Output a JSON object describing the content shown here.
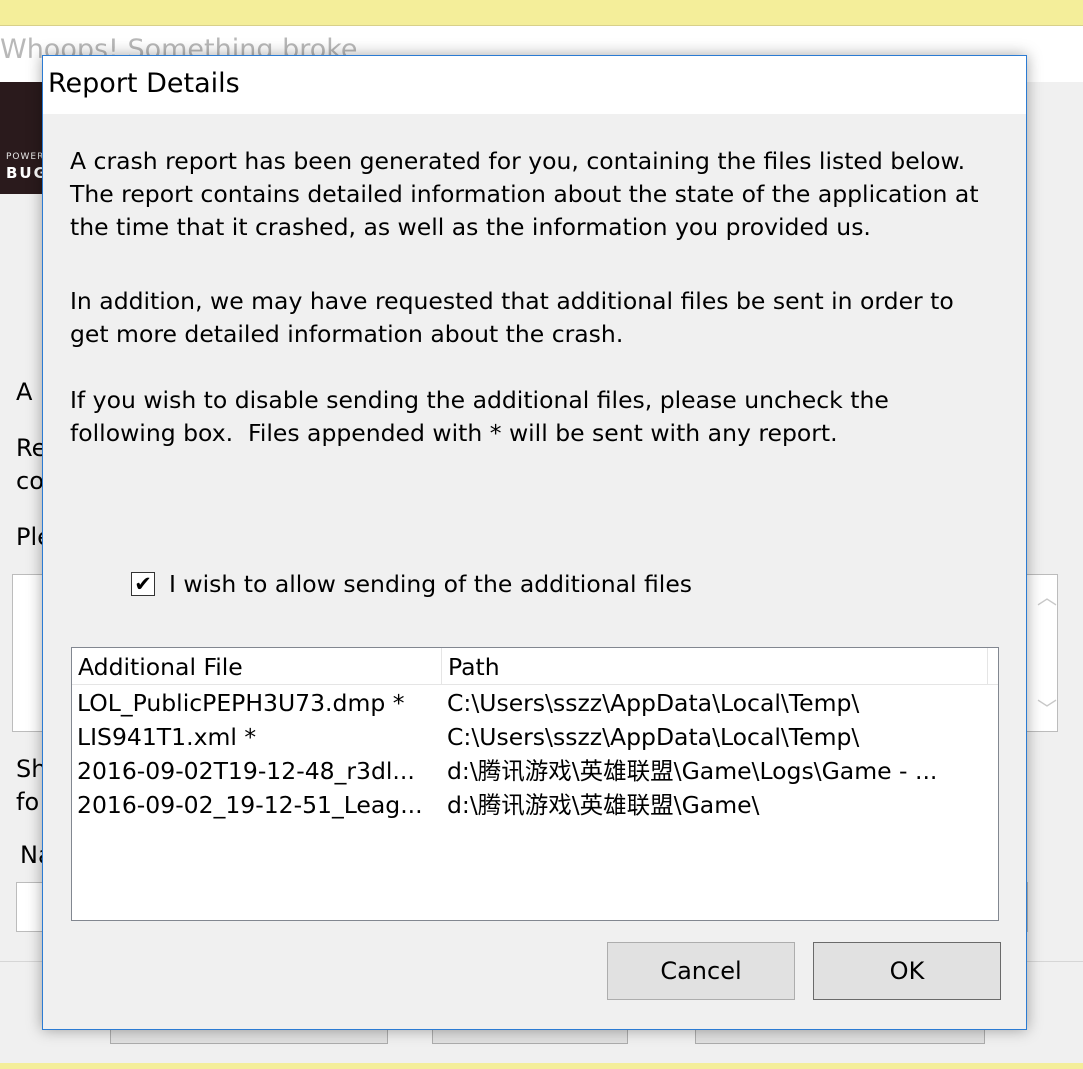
{
  "background_window": {
    "title": "Whoops! Something broke",
    "banner": {
      "powered": "POWERED",
      "brand": "BUG"
    },
    "labels": [
      "A",
      "Re",
      "co",
      "Ple",
      "Sh",
      "fo",
      "Na"
    ]
  },
  "dialog": {
    "title": "Report Details",
    "paragraph1": "A crash report has been generated for you, containing the files listed below.\nThe report contains detailed information about the state of the application at\nthe time that it crashed, as well as the information you provided us.",
    "paragraph2": "In addition, we may have requested that additional files be sent in order to\nget more detailed information about the crash.",
    "paragraph3": "If you wish to disable sending the additional files, please uncheck the\nfollowing box.  Files appended with * will be sent with any report.",
    "checkbox": {
      "checked": true,
      "mark": "✔",
      "label": "I wish to allow sending of the additional files"
    },
    "list": {
      "columns": [
        "Additional File",
        "Path"
      ],
      "rows": [
        {
          "file": "LOL_PublicPEPH3U73.dmp *",
          "path": "C:\\Users\\sszz\\AppData\\Local\\Temp\\"
        },
        {
          "file": "LIS941T1.xml *",
          "path": "C:\\Users\\sszz\\AppData\\Local\\Temp\\"
        },
        {
          "file": "2016-09-02T19-12-48_r3dl...",
          "path": "d:\\腾讯游戏\\英雄联盟\\Game\\Logs\\Game - ..."
        },
        {
          "file": "2016-09-02_19-12-51_Leag...",
          "path": "d:\\腾讯游戏\\英雄联盟\\Game\\"
        }
      ]
    },
    "buttons": {
      "cancel": "Cancel",
      "ok": "OK"
    }
  },
  "colors": {
    "accent_border": "#2b7bd3",
    "taskbar_strip": "#f4ee9a",
    "dialog_bg": "#f0f0f0"
  }
}
